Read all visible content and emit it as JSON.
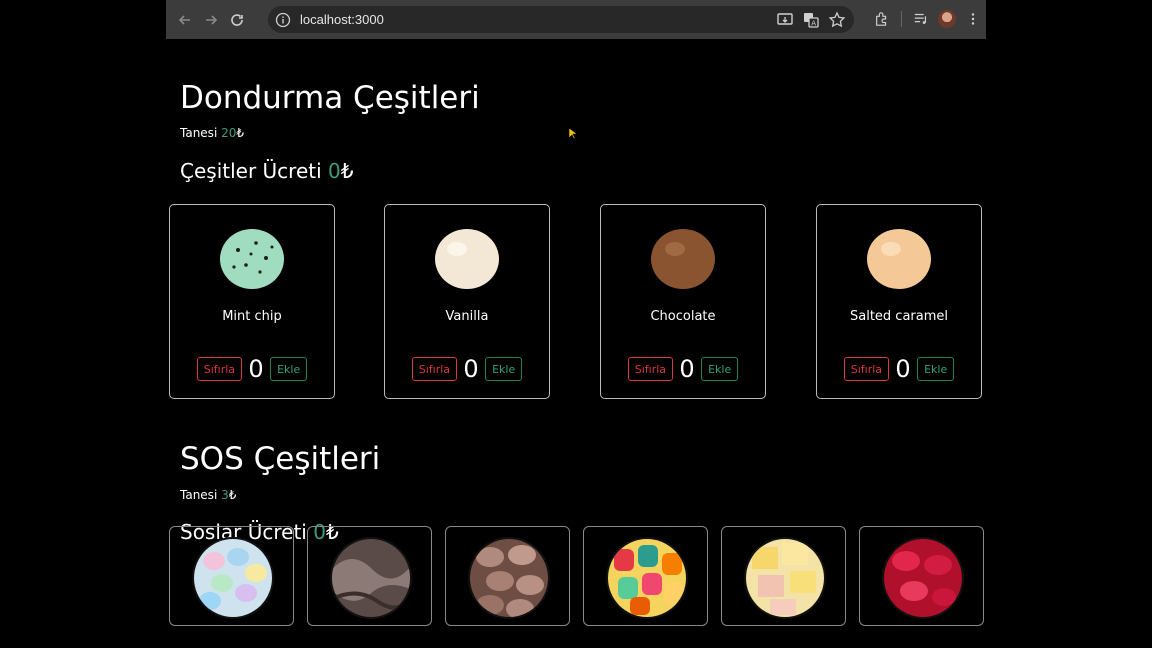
{
  "browser": {
    "url": "localhost:3000"
  },
  "icecream": {
    "title": "Dondurma Çeşitleri",
    "price_label": "Tanesi",
    "price_value": "20",
    "currency": "₺",
    "total_label": "Çeşitler Ücreti",
    "total_value": "0",
    "items": [
      {
        "name": "Mint chip",
        "count": "0",
        "reset_label": "Sıfırla",
        "add_label": "Ekle"
      },
      {
        "name": "Vanilla",
        "count": "0",
        "reset_label": "Sıfırla",
        "add_label": "Ekle"
      },
      {
        "name": "Chocolate",
        "count": "0",
        "reset_label": "Sıfırla",
        "add_label": "Ekle"
      },
      {
        "name": "Salted caramel",
        "count": "0",
        "reset_label": "Sıfırla",
        "add_label": "Ekle"
      }
    ]
  },
  "sauces": {
    "title": "SOS Çeşitleri",
    "price_label": "Tanesi",
    "price_value": "3",
    "currency": "₺",
    "total_label": "Soslar Ücreti",
    "total_value": "0",
    "items": [
      {
        "icon": "candy-eggs"
      },
      {
        "icon": "chocolate-sauce"
      },
      {
        "icon": "chocolate-chips"
      },
      {
        "icon": "gummy-bears"
      },
      {
        "icon": "turkish-delight"
      },
      {
        "icon": "red-candies"
      }
    ]
  }
}
